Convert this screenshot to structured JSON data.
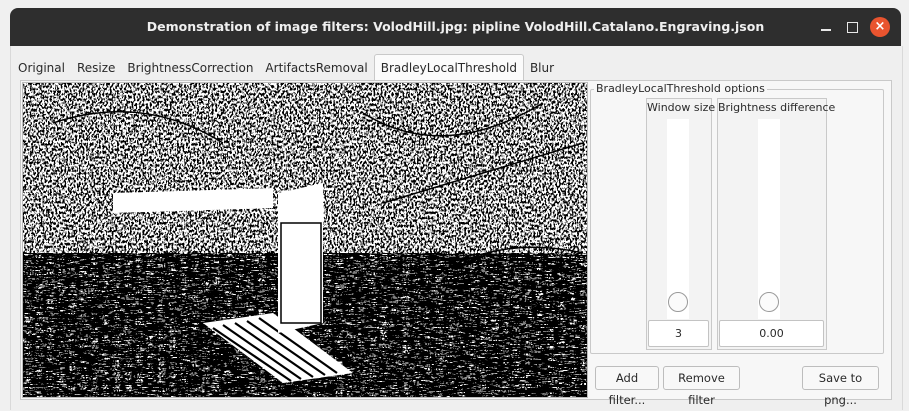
{
  "window": {
    "title": "Demonstration of image filters: VolodHill.jpg: pipline VolodHill.Catalano.Engraving.json"
  },
  "tabs": [
    {
      "label": "Original"
    },
    {
      "label": "Resize"
    },
    {
      "label": "BrightnessCorrection"
    },
    {
      "label": "ArtifactsRemoval"
    },
    {
      "label": "BradleyLocalThreshold",
      "active": true
    },
    {
      "label": "Blur"
    }
  ],
  "options": {
    "group_title": "BradleyLocalThreshold options",
    "window_size": {
      "label": "Window size",
      "value": "3"
    },
    "brightness_difference": {
      "label": "Brightness difference",
      "value": "0.00"
    }
  },
  "buttons": {
    "add_filter": "Add filter...",
    "remove_filter": "Remove filter",
    "save_png": "Save to png..."
  },
  "colors": {
    "titlebar": "#2e2e2e",
    "close_button": "#e9542f"
  }
}
